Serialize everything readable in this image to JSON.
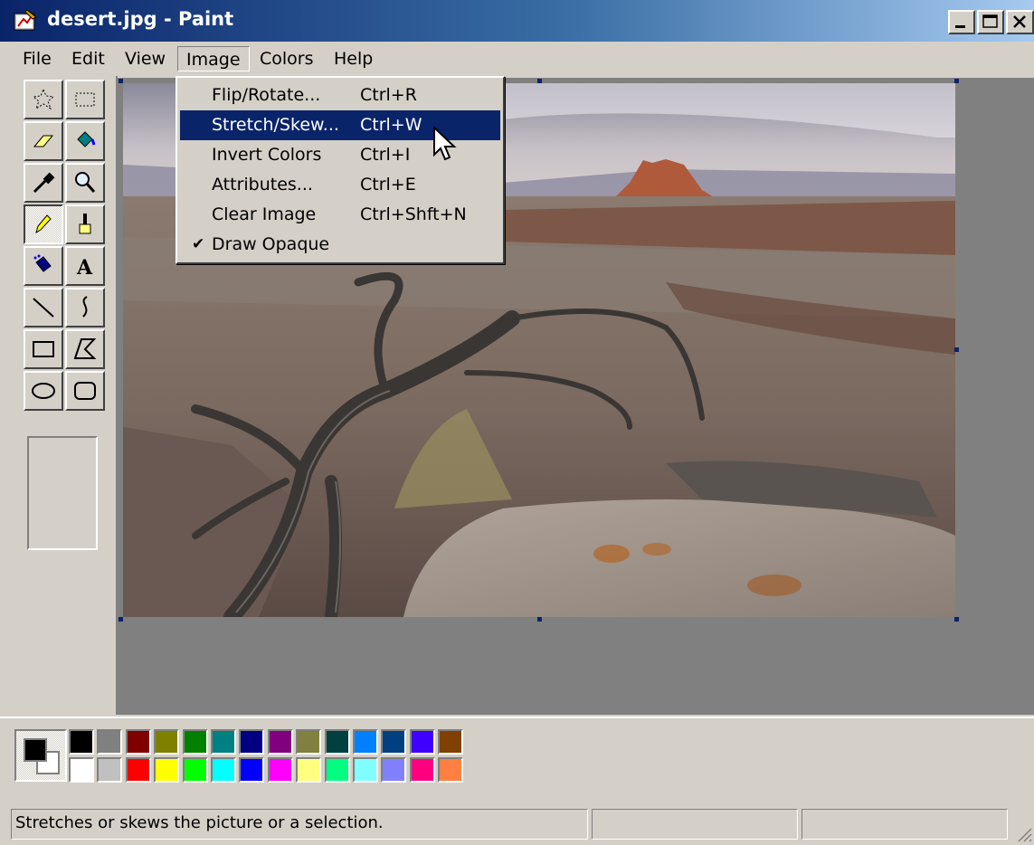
{
  "window": {
    "title": "desert.jpg - Paint"
  },
  "menubar": {
    "items": [
      "File",
      "Edit",
      "View",
      "Image",
      "Colors",
      "Help"
    ],
    "open_menu": "Image"
  },
  "image_menu": {
    "items": [
      {
        "label": "Flip/Rotate...",
        "shortcut": "Ctrl+R",
        "checked": false,
        "highlighted": false
      },
      {
        "label": "Stretch/Skew...",
        "shortcut": "Ctrl+W",
        "checked": false,
        "highlighted": true
      },
      {
        "label": "Invert Colors",
        "shortcut": "Ctrl+I",
        "checked": false,
        "highlighted": false
      },
      {
        "label": "Attributes...",
        "shortcut": "Ctrl+E",
        "checked": false,
        "highlighted": false
      },
      {
        "label": "Clear Image",
        "shortcut": "Ctrl+Shft+N",
        "checked": false,
        "highlighted": false
      },
      {
        "label": "Draw Opaque",
        "shortcut": "",
        "checked": true,
        "highlighted": false
      }
    ]
  },
  "toolbox": {
    "tools": [
      "free-form-select",
      "select",
      "eraser",
      "fill-with-color",
      "pick-color",
      "magnifier",
      "pencil",
      "brush",
      "airbrush",
      "text",
      "line",
      "curve",
      "rectangle",
      "polygon",
      "ellipse",
      "rounded-rectangle"
    ],
    "selected": "pencil",
    "text_tool_glyph": "A"
  },
  "colors": {
    "foreground": "#000000",
    "background": "#ffffff",
    "palette_top": [
      "#000000",
      "#808080",
      "#800000",
      "#808000",
      "#008000",
      "#008080",
      "#000080",
      "#800080",
      "#808040",
      "#004040",
      "#0080ff",
      "#004080",
      "#4000ff",
      "#804000"
    ],
    "palette_bottom": [
      "#ffffff",
      "#c0c0c0",
      "#ff0000",
      "#ffff00",
      "#00ff00",
      "#00ffff",
      "#0000ff",
      "#ff00ff",
      "#ffff80",
      "#00ff80",
      "#80ffff",
      "#8080ff",
      "#ff0080",
      "#ff8040"
    ]
  },
  "status": {
    "text": "Stretches or skews the picture or a selection."
  }
}
